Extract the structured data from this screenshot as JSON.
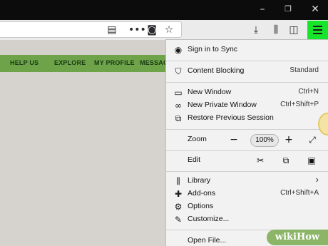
{
  "window": {
    "minimize_icon": "minimize-icon",
    "restore_icon": "restore-icon",
    "close_icon": "close-icon"
  },
  "toolbar": {
    "reader_icon": "reader-view-icon",
    "more_icon": "page-actions-icon",
    "pocket_icon": "pocket-icon",
    "bookmark_icon": "star-icon",
    "download_icon": "download-icon",
    "library_icon": "library-icon",
    "sidebar_icon": "sidebar-icon",
    "menu_icon": "hamburger-menu-icon",
    "menu_highlight": "#17e52a"
  },
  "site_nav": {
    "items": [
      "HELP US",
      "EXPLORE",
      "MY PROFILE",
      "MESSAG"
    ],
    "color": "#6fa34a"
  },
  "menu": {
    "sync": "Sign in to Sync",
    "content_blocking": "Content Blocking",
    "content_blocking_value": "Standard",
    "new_window": "New Window",
    "new_window_sc": "Ctrl+N",
    "private_window": "New Private Window",
    "private_window_sc": "Ctrl+Shift+P",
    "restore_session": "Restore Previous Session",
    "zoom": "Zoom",
    "zoom_minus": "−",
    "zoom_value": "100%",
    "zoom_plus": "+",
    "edit": "Edit",
    "library": "Library",
    "library_arrow": "›",
    "addons": "Add-ons",
    "addons_sc": "Ctrl+Shift+A",
    "options": "Options",
    "customize": "Customize...",
    "open_file": "Open File..."
  },
  "watermark": "wikiHow"
}
